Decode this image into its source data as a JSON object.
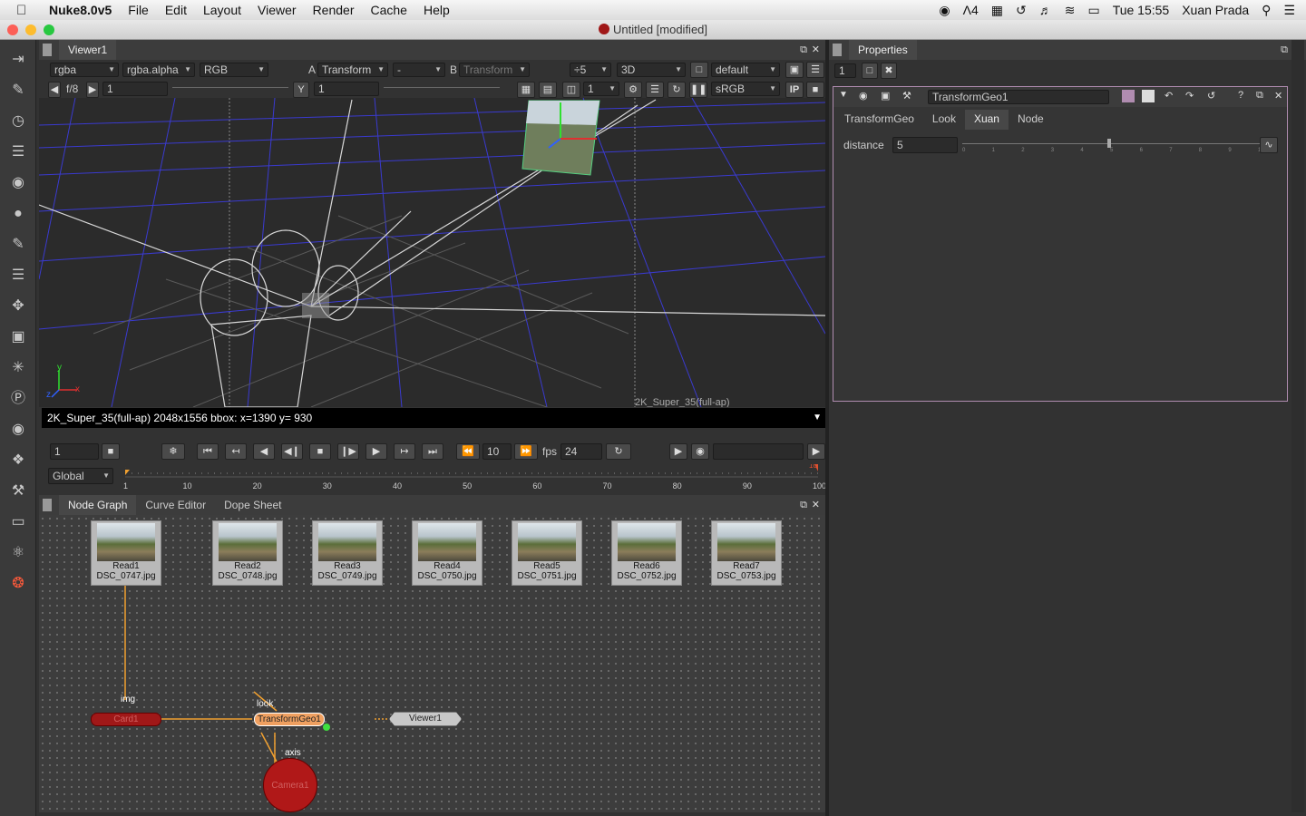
{
  "menubar": {
    "app_name": "Nuke8.0v5",
    "items": [
      "File",
      "Edit",
      "Layout",
      "Viewer",
      "Render",
      "Cache",
      "Help"
    ],
    "right": {
      "adobe_count": "4",
      "clock": "Tue 15:55",
      "user": "Xuan Prada"
    }
  },
  "window": {
    "title": "Untitled [modified]"
  },
  "viewer_panel": {
    "tab": "Viewer1",
    "row1": {
      "channels": "rgba",
      "alpha": "rgba.alpha",
      "display": "RGB",
      "a_label": "A",
      "a_input": "Transform",
      "dash": "-",
      "b_label": "B",
      "b_input": "Transform",
      "downrez": "÷5",
      "mode": "3D",
      "camera": "default"
    },
    "row2": {
      "fstop": "f/8",
      "gain": "1",
      "y_label": "Y",
      "gamma": "1",
      "proxy": "1",
      "lut": "sRGB",
      "ip": "IP"
    },
    "overlay_format": "2K_Super_35(full-ap)",
    "axis_labels": [
      "y",
      "x",
      "z"
    ],
    "info": "2K_Super_35(full-ap) 2048x1556 bbox:  x=1390 y= 930"
  },
  "playback": {
    "frame": "1",
    "step": "10",
    "fps_label": "fps",
    "fps": "24",
    "scope": "Global",
    "ticks": [
      "1",
      "10",
      "20",
      "30",
      "40",
      "50",
      "60",
      "70",
      "80",
      "90",
      "100"
    ],
    "in_marker": "1",
    "out_marker": "100"
  },
  "bottom_panel": {
    "tabs": [
      "Node Graph",
      "Curve Editor",
      "Dope Sheet"
    ],
    "read_nodes": [
      {
        "name": "Read1",
        "file": "DSC_0747.jpg"
      },
      {
        "name": "Read2",
        "file": "DSC_0748.jpg"
      },
      {
        "name": "Read3",
        "file": "DSC_0749.jpg"
      },
      {
        "name": "Read4",
        "file": "DSC_0750.jpg"
      },
      {
        "name": "Read5",
        "file": "DSC_0751.jpg"
      },
      {
        "name": "Read6",
        "file": "DSC_0752.jpg"
      },
      {
        "name": "Read7",
        "file": "DSC_0753.jpg"
      }
    ],
    "card": "Card1",
    "transform": "TransformGeo1",
    "viewer": "Viewer1",
    "camera": "Camera1",
    "edge_labels": {
      "img": "img",
      "look": "look",
      "axis": "axis"
    }
  },
  "properties": {
    "title": "Properties",
    "max_panels": "1",
    "node_name": "TransformGeo1",
    "tabs": [
      "TransformGeo",
      "Look",
      "Xuan",
      "Node"
    ],
    "active_tab": "Xuan",
    "knob_label": "distance",
    "knob_value": "5",
    "slider_ticks": [
      "0",
      "1",
      "2",
      "3",
      "4",
      "5",
      "6",
      "7",
      "8",
      "9",
      "10"
    ]
  },
  "colors": {
    "accent_orange": "#f0a030",
    "node_red": "#b01818",
    "prop_border": "#b08cb0",
    "grid_blue": "#3a3ad0"
  }
}
